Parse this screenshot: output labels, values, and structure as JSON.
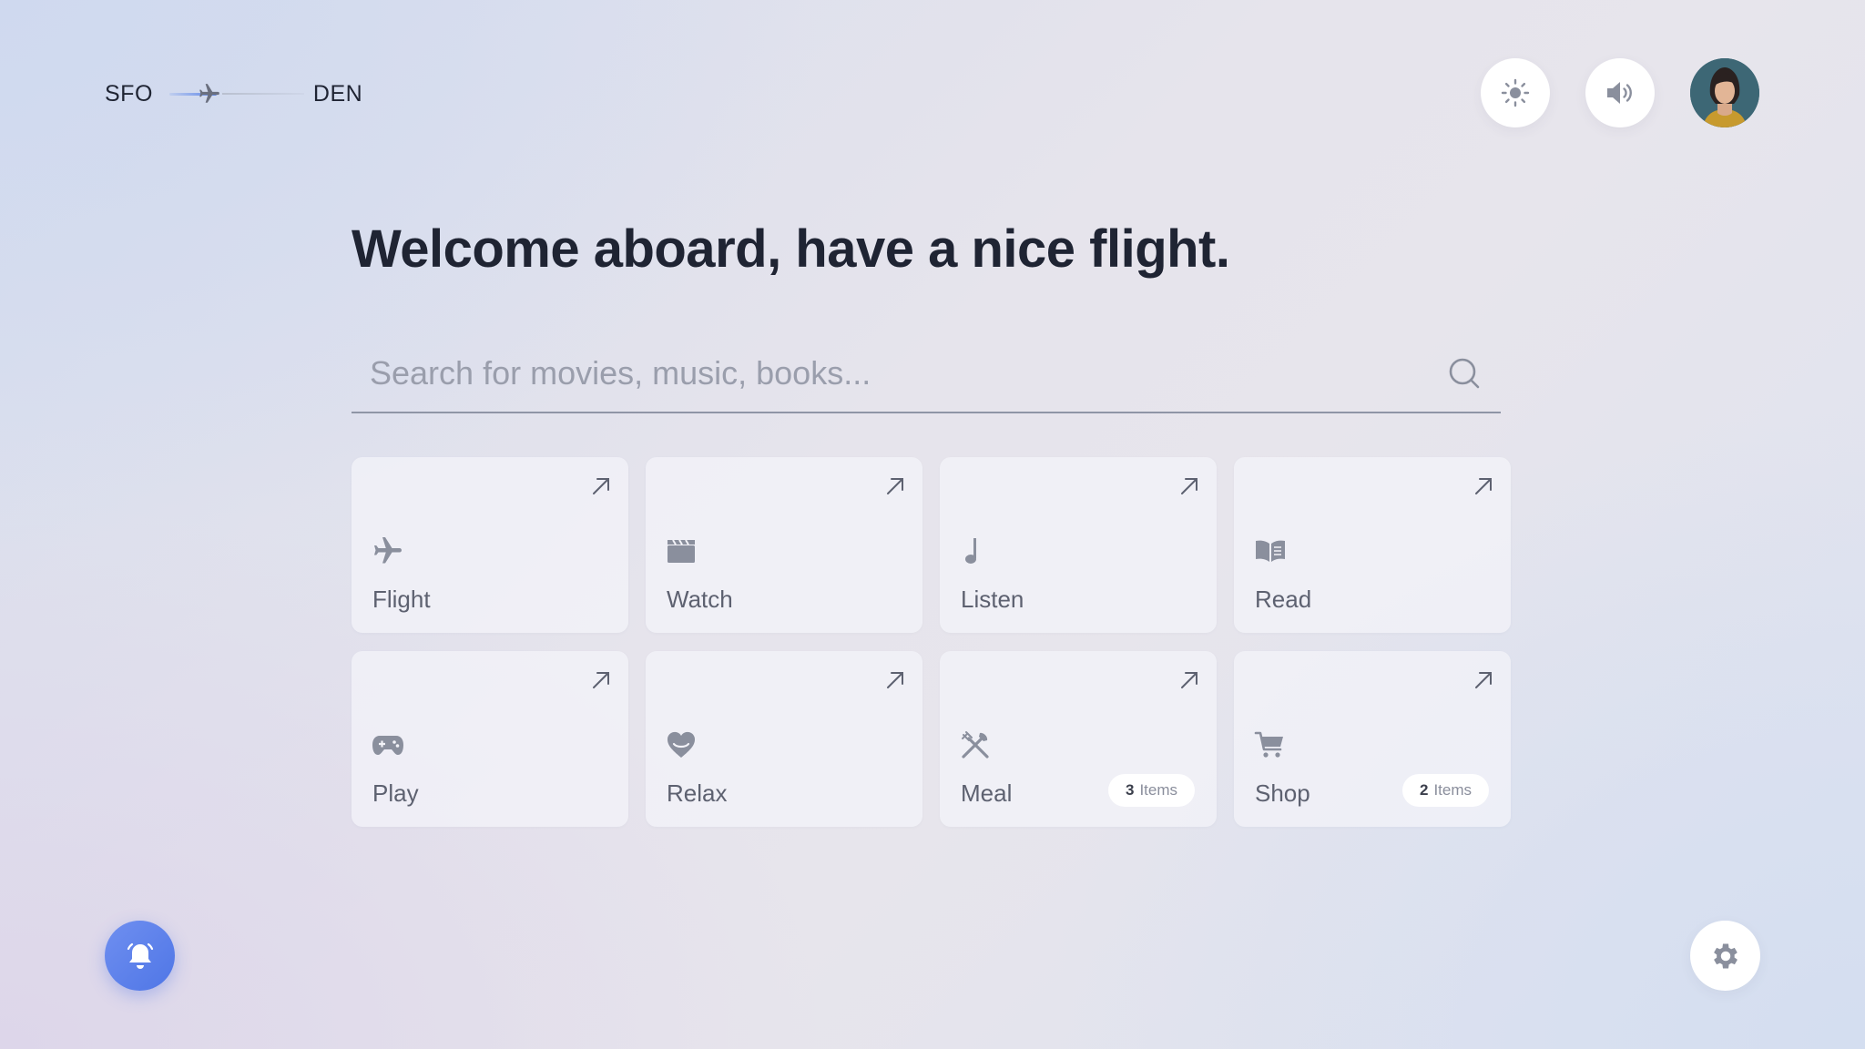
{
  "route": {
    "origin": "SFO",
    "destination": "DEN",
    "progress": 0.35
  },
  "header_controls": {
    "brightness_icon": "sun-icon",
    "volume_icon": "speaker-icon",
    "profile": "avatar"
  },
  "headline": "Welcome aboard, have a nice flight.",
  "search": {
    "placeholder": "Search for movies, music, books...",
    "value": "",
    "icon": "search-icon"
  },
  "categories": [
    {
      "label": "Flight",
      "icon": "airplane-icon"
    },
    {
      "label": "Watch",
      "icon": "clapperboard-icon"
    },
    {
      "label": "Listen",
      "icon": "music-note-icon"
    },
    {
      "label": "Read",
      "icon": "book-icon"
    },
    {
      "label": "Play",
      "icon": "gamepad-icon"
    },
    {
      "label": "Relax",
      "icon": "heart-icon"
    },
    {
      "label": "Meal",
      "icon": "utensils-icon",
      "badge_count": "3",
      "badge_text": "Items"
    },
    {
      "label": "Shop",
      "icon": "cart-icon",
      "badge_count": "2",
      "badge_text": "Items"
    }
  ],
  "footer": {
    "notifications_icon": "bell-icon",
    "settings_icon": "gear-icon"
  },
  "colors": {
    "accent": "#5b84e8",
    "text": "#1f2433",
    "muted": "#5d6170"
  }
}
